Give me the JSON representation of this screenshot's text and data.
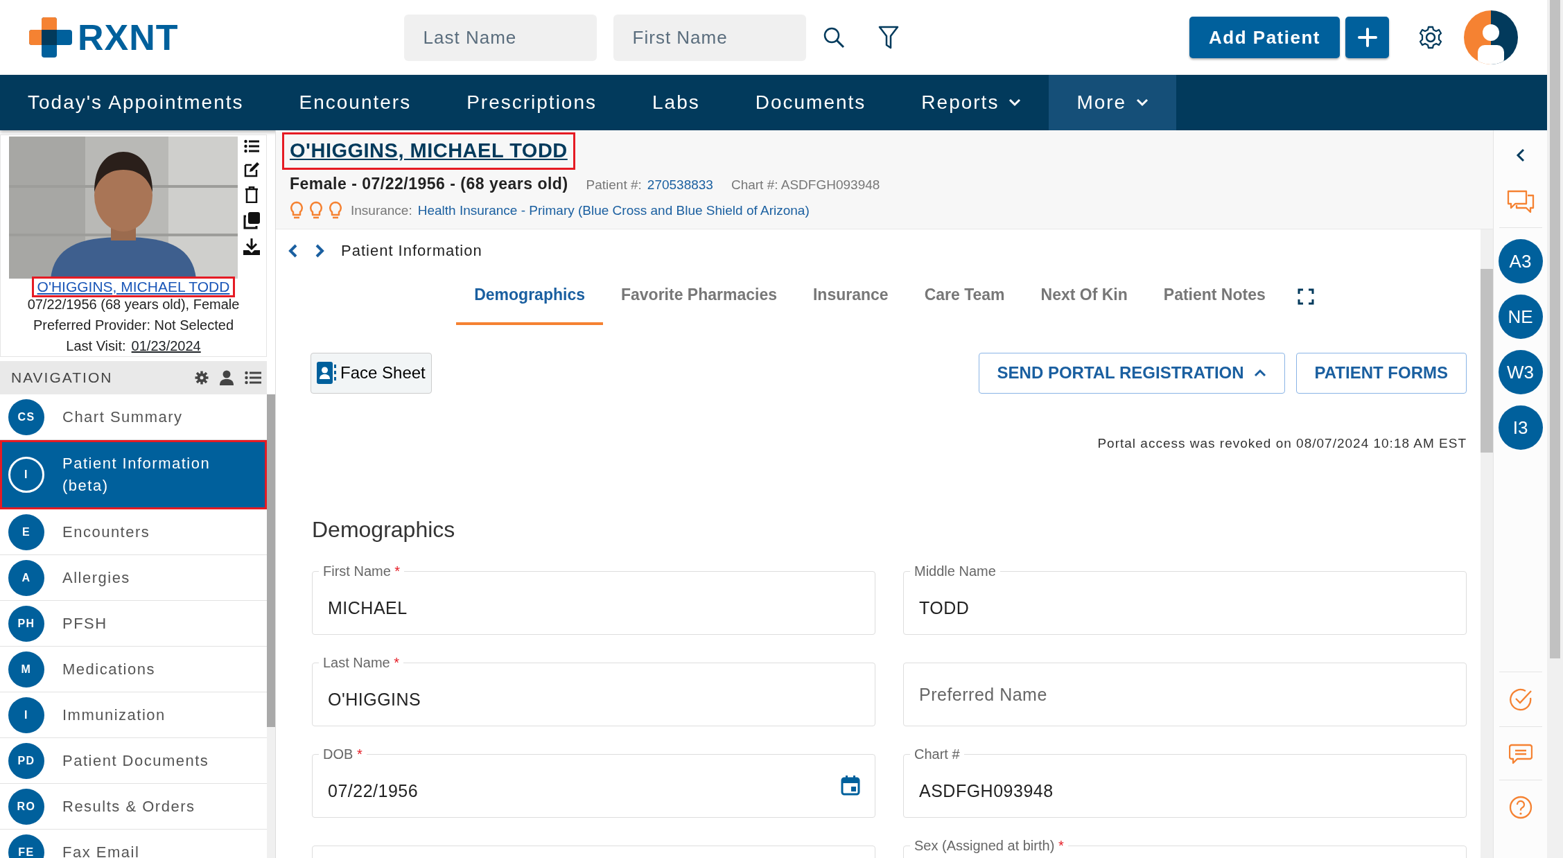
{
  "header": {
    "logo": "RXNT",
    "search_fields": [
      {
        "placeholder": "Last Name"
      },
      {
        "placeholder": "First Name"
      }
    ],
    "add_button": "Add Patient"
  },
  "main_nav": [
    {
      "label": "Today's Appointments",
      "dropdown": false,
      "selected": false
    },
    {
      "label": "Encounters",
      "dropdown": false,
      "selected": false
    },
    {
      "label": "Prescriptions",
      "dropdown": false,
      "selected": false
    },
    {
      "label": "Labs",
      "dropdown": false,
      "selected": false
    },
    {
      "label": "Documents",
      "dropdown": false,
      "selected": false
    },
    {
      "label": "Reports",
      "dropdown": true,
      "selected": false
    },
    {
      "label": "More",
      "dropdown": true,
      "selected": true
    }
  ],
  "patient_card": {
    "name": "O'HIGGINS, MICHAEL TODD",
    "highlighted": true,
    "dob_line": "07/22/1956 (68 years old), Female",
    "provider": "Preferred Provider: Not Selected",
    "last_visit_label": "Last Visit:",
    "last_visit": "01/23/2024"
  },
  "navigation": {
    "title": "NAVIGATION",
    "items": [
      {
        "abbr": "CS",
        "label": "Chart Summary",
        "selected": false,
        "highlighted": false
      },
      {
        "abbr": "I",
        "label": "Patient Information (beta)",
        "selected": true,
        "highlighted": true
      },
      {
        "abbr": "E",
        "label": "Encounters",
        "selected": false,
        "highlighted": false
      },
      {
        "abbr": "A",
        "label": "Allergies",
        "selected": false,
        "highlighted": false
      },
      {
        "abbr": "PH",
        "label": "PFSH",
        "selected": false,
        "highlighted": false
      },
      {
        "abbr": "M",
        "label": "Medications",
        "selected": false,
        "highlighted": false
      },
      {
        "abbr": "I",
        "label": "Immunization",
        "selected": false,
        "highlighted": false
      },
      {
        "abbr": "PD",
        "label": "Patient Documents",
        "selected": false,
        "highlighted": false
      },
      {
        "abbr": "RO",
        "label": "Results & Orders",
        "selected": false,
        "highlighted": false
      },
      {
        "abbr": "FE",
        "label": "Fax Email",
        "selected": false,
        "highlighted": false
      }
    ]
  },
  "patient_header": {
    "name": "O'HIGGINS, MICHAEL TODD",
    "highlighted": true,
    "summary": "Female - 07/22/1956 - (68 years old)",
    "patient_no_label": "Patient #:",
    "patient_no": "270538833",
    "chart_no": "Chart #: ASDFGH093948",
    "insurance_label": "Insurance:",
    "insurance": "Health Insurance - Primary (Blue Cross and Blue Shield of Arizona)"
  },
  "breadcrumb": "Patient Information",
  "tabs": [
    {
      "label": "Demographics",
      "selected": true
    },
    {
      "label": "Favorite Pharmacies",
      "selected": false
    },
    {
      "label": "Insurance",
      "selected": false
    },
    {
      "label": "Care Team",
      "selected": false
    },
    {
      "label": "Next Of Kin",
      "selected": false
    },
    {
      "label": "Patient Notes",
      "selected": false
    }
  ],
  "face_sheet": "Face Sheet",
  "actions": [
    {
      "label": "SEND PORTAL REGISTRATION",
      "dropdown": true
    },
    {
      "label": "PATIENT FORMS",
      "dropdown": false
    }
  ],
  "portal_note": "Portal access was revoked on 08/07/2024 10:18 AM EST",
  "section_title": "Demographics",
  "fields": [
    {
      "kind": "text",
      "label": "First Name",
      "required": true,
      "value": "MICHAEL"
    },
    {
      "kind": "text",
      "label": "Middle Name",
      "required": false,
      "value": "TODD"
    },
    {
      "kind": "text",
      "label": "Last Name",
      "required": true,
      "value": "O'HIGGINS"
    },
    {
      "kind": "text",
      "placeholder": "Preferred Name"
    },
    {
      "kind": "date",
      "label": "DOB",
      "required": true,
      "value": "07/22/1956"
    },
    {
      "kind": "text",
      "label": "Chart #",
      "required": false,
      "value": "ASDFGH093948"
    },
    {
      "kind": "text"
    },
    {
      "kind": "text",
      "label": "Sex (Assigned at birth)",
      "required": true
    }
  ],
  "required_marker": "*",
  "right_rail": {
    "badges": [
      "A3",
      "NE",
      "W3",
      "I3"
    ]
  }
}
